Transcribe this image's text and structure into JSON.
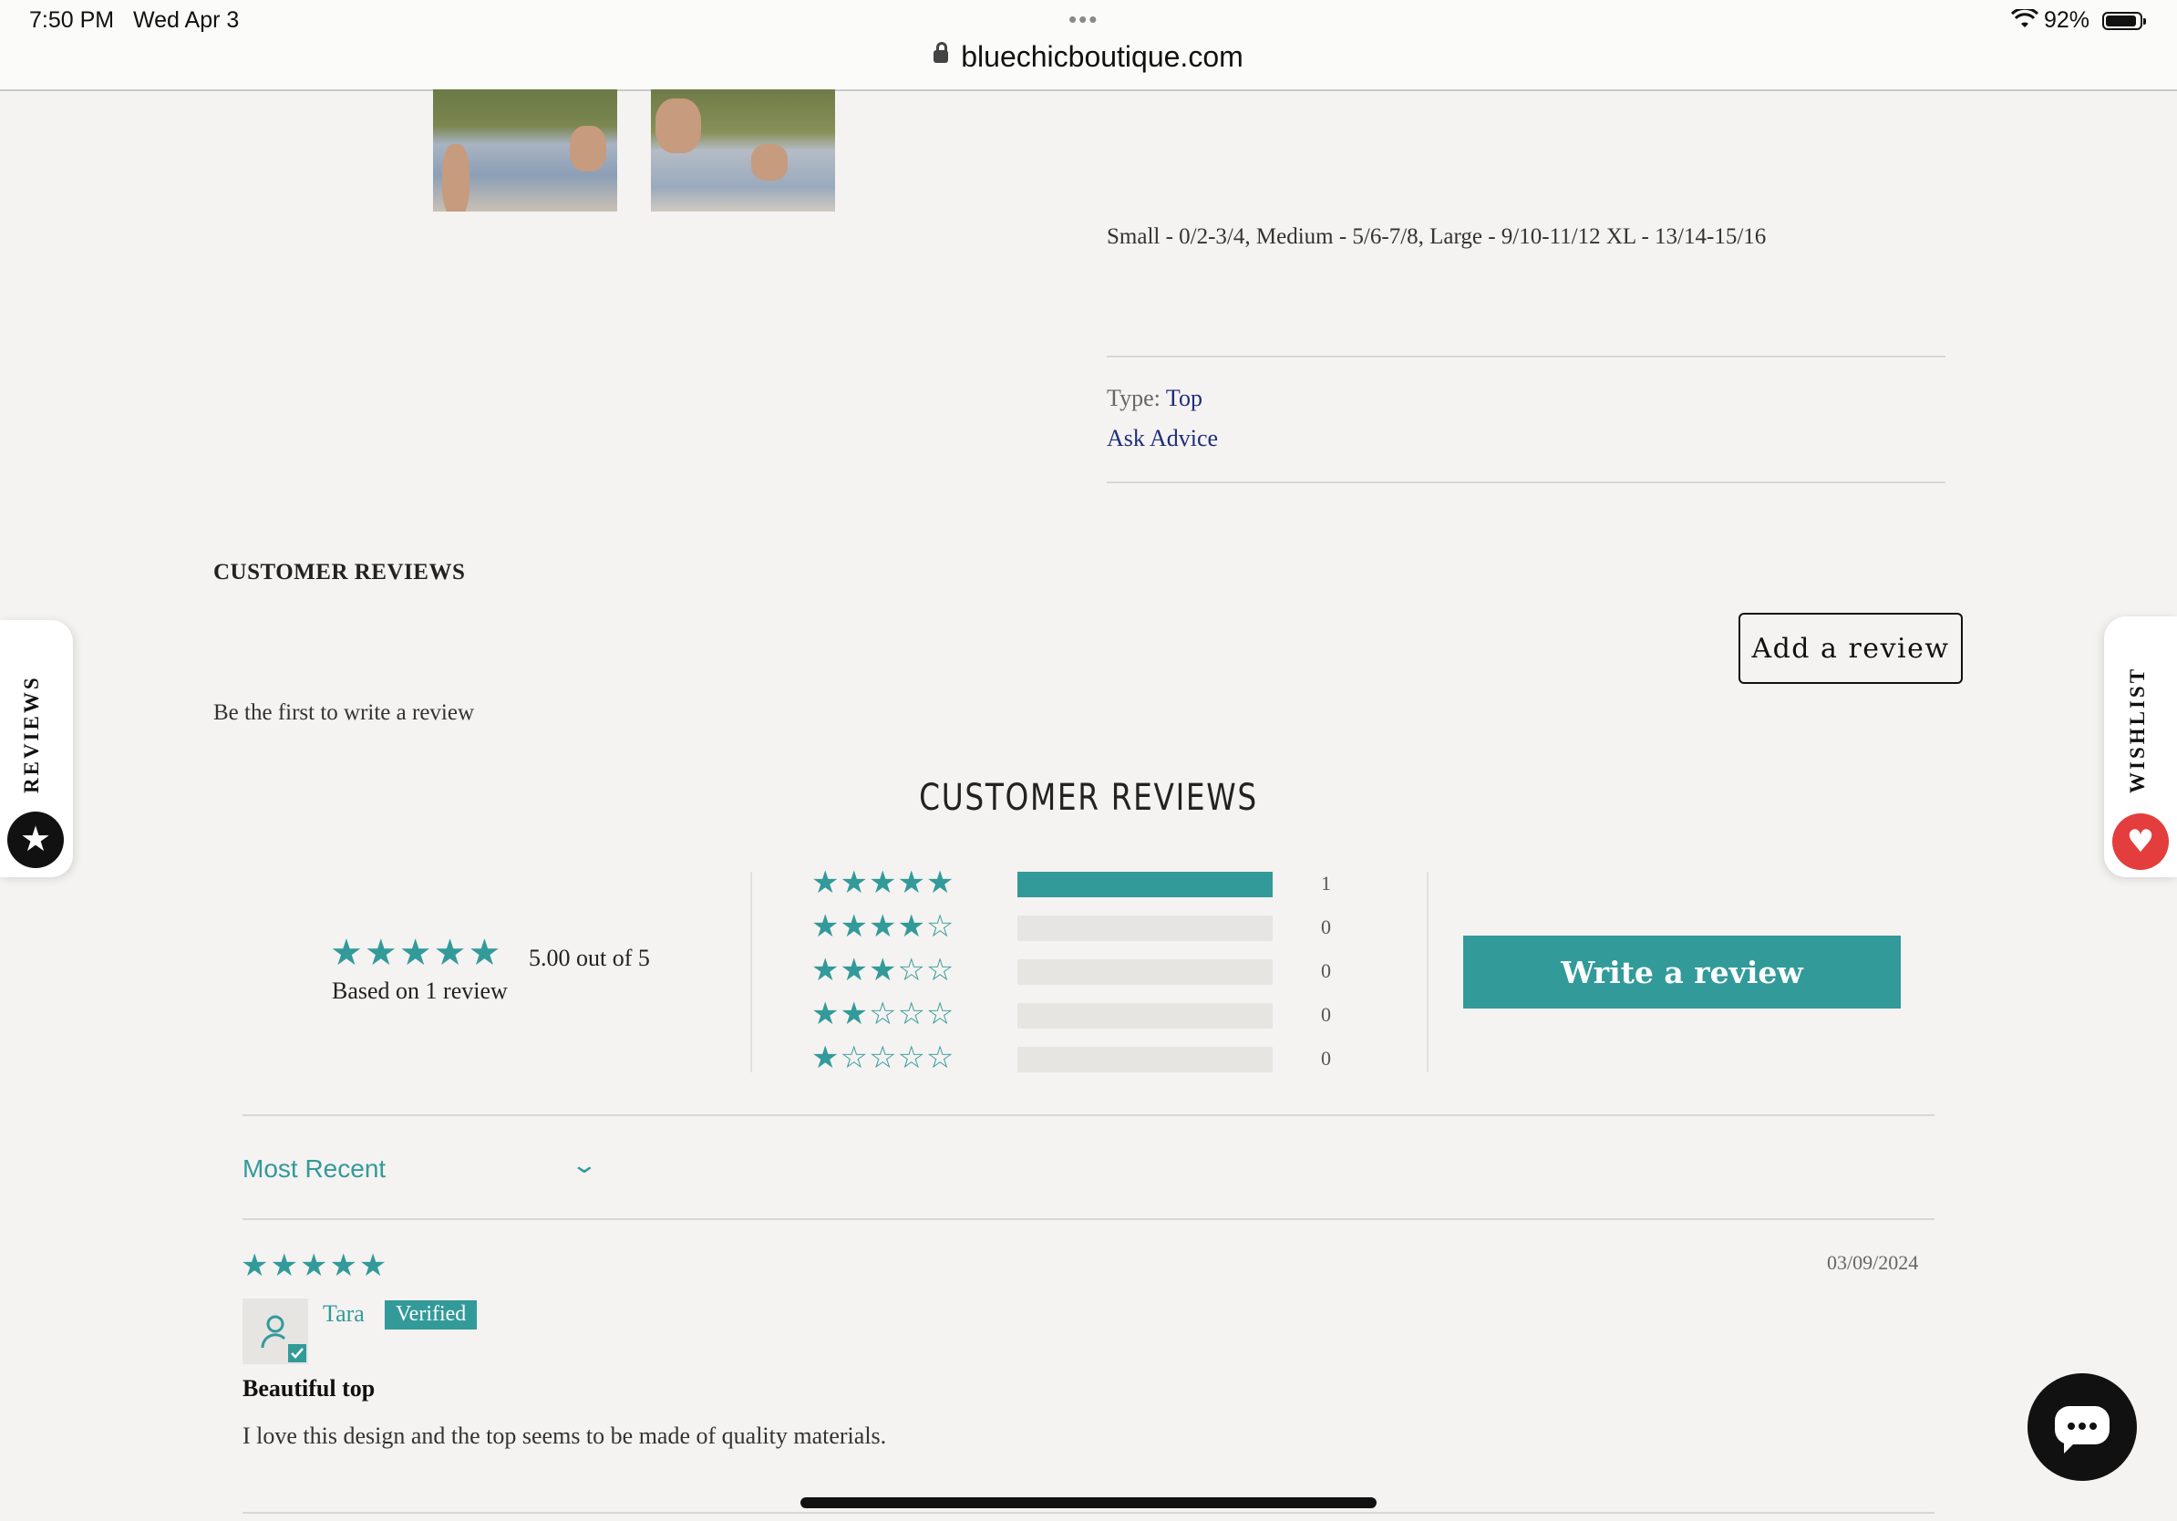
{
  "status_bar": {
    "time": "7:50 PM",
    "date": "Wed Apr 3",
    "battery": "92%",
    "url": "bluechicboutique.com",
    "more": "•••"
  },
  "product": {
    "sizes": "Small - 0/2-3/4, Medium - 5/6-7/8, Large - 9/10-11/12 XL - 13/14-15/16",
    "type_label": "Type: ",
    "type_value": "Top",
    "ask_advice": "Ask Advice"
  },
  "reviews_section": {
    "heading": "CUSTOMER REVIEWS",
    "add_review_label": "Add a review",
    "empty_text": "Be the first to write a review"
  },
  "side_tabs": {
    "reviews": "REVIEWS",
    "wishlist": "WISHLIST"
  },
  "widget": {
    "title": "CUSTOMER REVIEWS",
    "average_text": "5.00 out of 5",
    "based_on": "Based on 1 review",
    "histogram": [
      {
        "stars": "★★★★★",
        "count": "1",
        "fraction": 1
      },
      {
        "stars": "★★★★☆",
        "count": "0",
        "fraction": 0
      },
      {
        "stars": "★★★☆☆",
        "count": "0",
        "fraction": 0
      },
      {
        "stars": "★★☆☆☆",
        "count": "0",
        "fraction": 0
      },
      {
        "stars": "★☆☆☆☆",
        "count": "0",
        "fraction": 0
      }
    ],
    "write_review_label": "Write a review",
    "sort_label": "Most Recent"
  },
  "review": {
    "stars": "★★★★★",
    "date": "03/09/2024",
    "author": "Tara",
    "badge": "Verified",
    "title": "Beautiful top",
    "body": "I love this design and the top seems to be made of quality materials."
  },
  "icons": {
    "lock": "lock-icon",
    "wifi": "wifi-icon",
    "battery": "battery-icon",
    "star": "star-icon",
    "heart": "heart-icon",
    "chat": "chat-icon",
    "chevron": "chevron-down-icon",
    "user": "user-icon"
  },
  "colors": {
    "accent": "#339a9a",
    "link": "#1e2e7a",
    "wishlist_badge": "#e43d3d"
  }
}
